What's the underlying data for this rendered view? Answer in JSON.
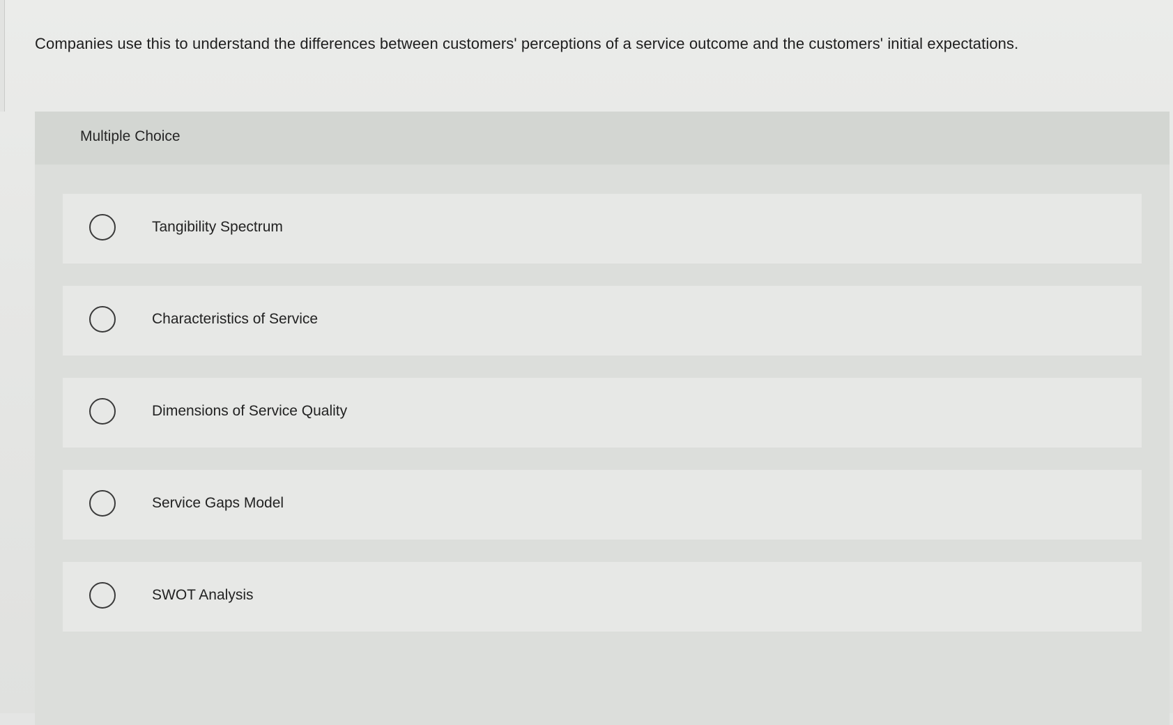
{
  "question": {
    "text": "Companies use this to understand the differences between customers' perceptions of a service outcome and the customers' initial expectations."
  },
  "multiple_choice": {
    "header_label": "Multiple Choice",
    "options": [
      {
        "label": "Tangibility Spectrum",
        "selected": false
      },
      {
        "label": "Characteristics of Service",
        "selected": false
      },
      {
        "label": "Dimensions of Service Quality",
        "selected": false
      },
      {
        "label": "Service Gaps Model",
        "selected": false
      },
      {
        "label": "SWOT Analysis",
        "selected": false
      }
    ]
  },
  "colors": {
    "page_background": "#e6e7e5",
    "panel_background": "#dcdedb",
    "header_background": "#d3d6d2",
    "option_background": "#e7e8e6",
    "radio_border": "#3a3a3a"
  }
}
